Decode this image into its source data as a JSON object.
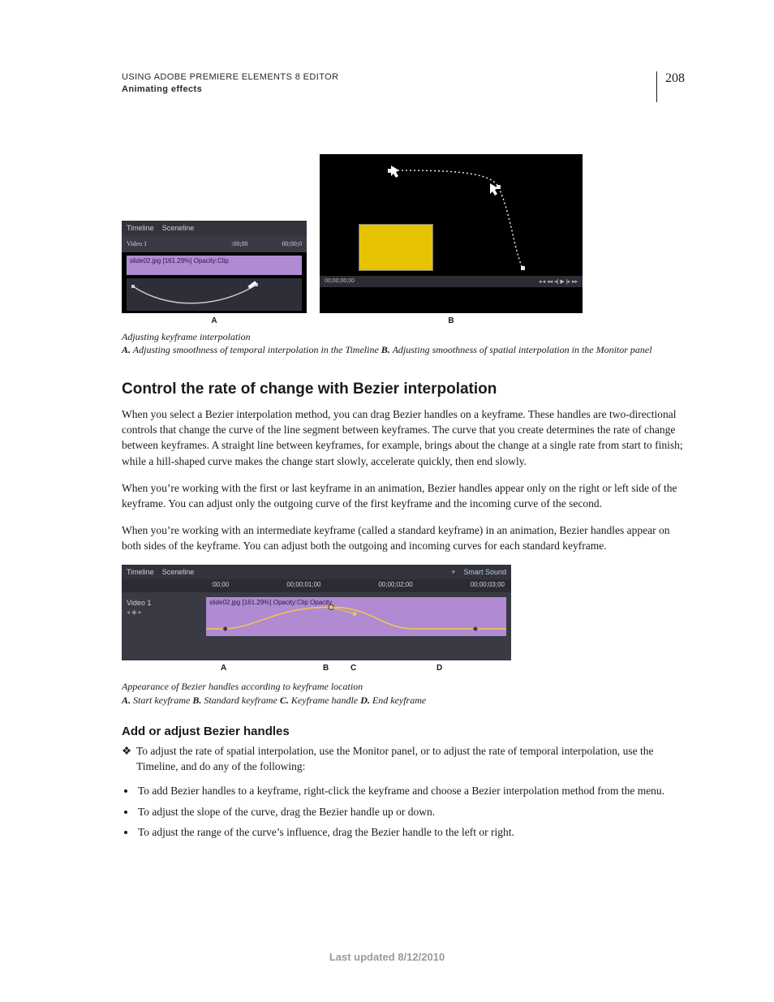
{
  "header": {
    "product_line": "USING ADOBE PREMIERE ELEMENTS 8 EDITOR",
    "chapter": "Animating effects",
    "page_number": "208"
  },
  "figure1": {
    "panelA": {
      "tabs": [
        "Timeline",
        "Sceneline"
      ],
      "track_label": "Video 1",
      "time_start": ":00;00",
      "time_end": "00;00;0",
      "clip_text": "slide02.jpg [161.29%] Opacity:Clip"
    },
    "panelB": {
      "timecode": "00;00;00;00"
    },
    "letters": {
      "a": "A",
      "b": "B"
    },
    "caption_lead": "Adjusting keyframe interpolation",
    "caption_a_key": "A.",
    "caption_a_text": " Adjusting smoothness of temporal interpolation in the Timeline  ",
    "caption_b_key": "B.",
    "caption_b_text": " Adjusting smoothness of spatial interpolation in the Monitor panel"
  },
  "section": {
    "heading": "Control the rate of change with Bezier interpolation",
    "p1": "When you select a Bezier interpolation method, you can drag Bezier handles on a keyframe. These handles are two-directional controls that change the curve of the line segment between keyframes. The curve that you create determines the rate of change between keyframes. A straight line between keyframes, for example, brings about the change at a single rate from start to finish; while a hill-shaped curve makes the change start slowly, accelerate quickly, then end slowly.",
    "p2": "When you’re working with the first or last keyframe in an animation, Bezier handles appear only on the right or left side of the keyframe. You can adjust only the outgoing curve of the first keyframe and the incoming curve of the second.",
    "p3": "When you’re working with an intermediate keyframe (called a standard keyframe) in an animation, Bezier handles appear on both sides of the keyframe. You can adjust both the outgoing and incoming curves for each standard keyframe."
  },
  "figure2": {
    "tabs": [
      "Timeline",
      "Sceneline"
    ],
    "smart_sound": "Smart Sound",
    "ruler": [
      ":00;00",
      "00;00;01;00",
      "00;00;02;00",
      "00;00;03;00"
    ],
    "track_label": "Video 1",
    "clip_text": "slide02.jpg [161.29%] Opacity:Clip Opacity",
    "letters": {
      "a": "A",
      "b": "B",
      "c": "C",
      "d": "D"
    },
    "caption_lead": "Appearance of Bezier handles according to keyframe location",
    "caption_a_key": "A.",
    "caption_a_text": " Start keyframe  ",
    "caption_b_key": "B.",
    "caption_b_text": " Standard keyframe  ",
    "caption_c_key": "C.",
    "caption_c_text": " Keyframe handle  ",
    "caption_d_key": "D.",
    "caption_d_text": " End keyframe"
  },
  "subsection": {
    "heading": "Add or adjust Bezier handles",
    "lead_item": "To adjust the rate of spatial interpolation, use the Monitor panel, or to adjust the rate of temporal interpolation, use the Timeline, and do any of the following:",
    "bullets": [
      "To add Bezier handles to a keyframe, right-click the keyframe and choose a Bezier interpolation method from the menu.",
      "To adjust the slope of the curve, drag the Bezier handle up or down.",
      "To adjust the range of the curve’s influence, drag the Bezier handle to the left or right."
    ]
  },
  "footer": {
    "last_updated": "Last updated 8/12/2010"
  }
}
